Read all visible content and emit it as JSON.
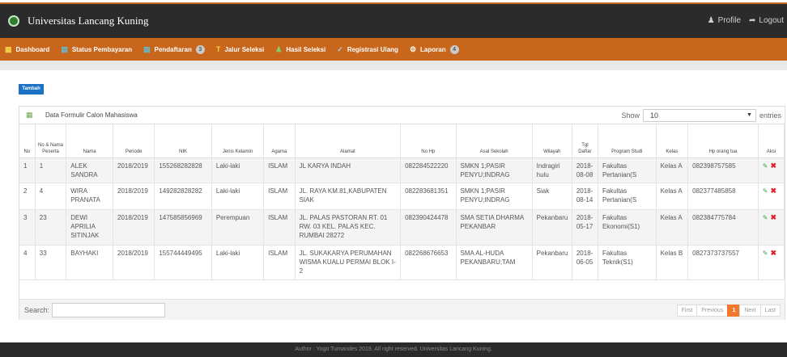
{
  "app": {
    "title": "Universitas Lancang Kuning",
    "profile_label": "Profile",
    "logout_label": "Logout"
  },
  "menu": {
    "items": [
      {
        "label": "Dashboard",
        "icon": "grid-icon"
      },
      {
        "label": "Status Pembayaran",
        "icon": "document-icon"
      },
      {
        "label": "Pendaftaran",
        "icon": "list-icon",
        "badge": "3"
      },
      {
        "label": "Jalur Seleksi",
        "icon": "trophy-icon"
      },
      {
        "label": "Hasil Seleksi",
        "icon": "user-icon"
      },
      {
        "label": "Registrasi Ulang",
        "icon": "check-icon"
      },
      {
        "label": "Laporan",
        "icon": "gear-icon",
        "badge": "4"
      }
    ]
  },
  "toolbar": {
    "add_label": "Tambah"
  },
  "panel": {
    "title": "Data Formulir Calon Mahasiswa",
    "show_label": "Show",
    "show_value": "10",
    "entries_label": "entries"
  },
  "table": {
    "headers": [
      "No",
      "No & Nama Peserta",
      "Nama",
      "Periode",
      "NIK",
      "Jenis Kelamin",
      "Agama",
      "Alamat",
      "No Hp",
      "Asal Sekolah",
      "Wilayah",
      "Tgl Daftar",
      "Program Studi",
      "Kelas",
      "Hp orang tua",
      "Aksi"
    ],
    "rows": [
      [
        "1",
        "1",
        "ALEK SANDRA",
        "2018/2019",
        "155268282828",
        "Laki-laki",
        "ISLAM",
        "JL KARYA INDAH",
        "082284522220",
        "SMKN 1;PASIR PENYU;INDRAG",
        "Indragiri hulu",
        "2018-08-08",
        "Fakultas Pertanian(S",
        "Kelas A",
        "082398757585"
      ],
      [
        "2",
        "4",
        "WIRA PRANATA",
        "2018/2019",
        "149282828282",
        "Laki-laki",
        "ISLAM",
        "JL. RAYA KM.81,KABUPATEN SIAK",
        "082283681351",
        "SMKN 1;PASIR PENYU;INDRAG",
        "Siak",
        "2018-08-14",
        "Fakultas Pertanian(S",
        "Kelas A",
        "082377485858"
      ],
      [
        "3",
        "23",
        "DEWI APRILIA SITINJAK",
        "2018/2019",
        "147585856969",
        "Perempuan",
        "ISLAM",
        "JL. PALAS PASTORAN RT. 01 RW. 03 KEL. PALAS KEC. RUMBAI 28272",
        "082390424478",
        "SMA SETIA DHARMA PEKANBAR",
        "Pekanbaru",
        "2018-05-17",
        "Fakultas Ekonomi(S1)",
        "Kelas A",
        "082384775784"
      ],
      [
        "4",
        "33",
        "BAYHAKI",
        "2018/2019",
        "155744449495",
        "Laki-laki",
        "ISLAM",
        "JL. SUKAKARYA PERUMAHAN WISMA KUALU PERMAI BLOK I-2",
        "082268676653",
        "SMA AL-HUDA PEKANBARU;TAM",
        "Pekanbaru",
        "2018-06-05",
        "Fakultas Teknik(S1)",
        "Kelas B",
        "0827373737557"
      ]
    ]
  },
  "search": {
    "label": "Search:",
    "value": ""
  },
  "pagination": {
    "first": "First",
    "previous": "Previous",
    "current": "1",
    "next": "Next",
    "last": "Last"
  },
  "footer": {
    "text": "Author : Yogo Turnandes 2019. All right reserved. Universitas Lancang Kuning."
  },
  "colors": {
    "navbar": "#2b2b2b",
    "menubar": "#c8661b",
    "primary_button": "#1b72c4",
    "active_page": "#f0772b"
  }
}
